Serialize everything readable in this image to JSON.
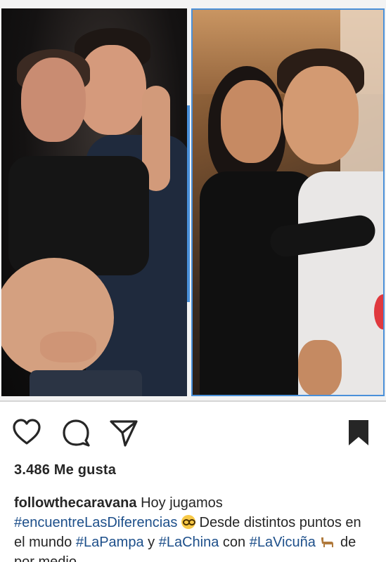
{
  "post": {
    "likes_text": "3.486 Me gusta",
    "caption": {
      "username": "followthecaravana",
      "text_1": " Hoy jugamos ",
      "tag_1": "#encuentreLasDiferencias",
      "emoji_1": "nerd-face-emoji",
      "text_2": " Desde distintos puntos en el mundo ",
      "tag_2": "#LaPampa",
      "text_3": " y ",
      "tag_3": "#LaChina",
      "text_4": " con ",
      "tag_4": "#LaVicuña",
      "emoji_2": "llama-emoji",
      "text_5": " de por medio"
    }
  },
  "actions": {
    "like_icon": "heart-outline-icon",
    "comment_icon": "comment-bubble-icon",
    "share_icon": "paper-plane-icon",
    "save_icon": "bookmark-filled-icon"
  },
  "colors": {
    "text": "#262626",
    "hashtag": "#1d4f8a",
    "frame_accent": "#4a90d9"
  }
}
